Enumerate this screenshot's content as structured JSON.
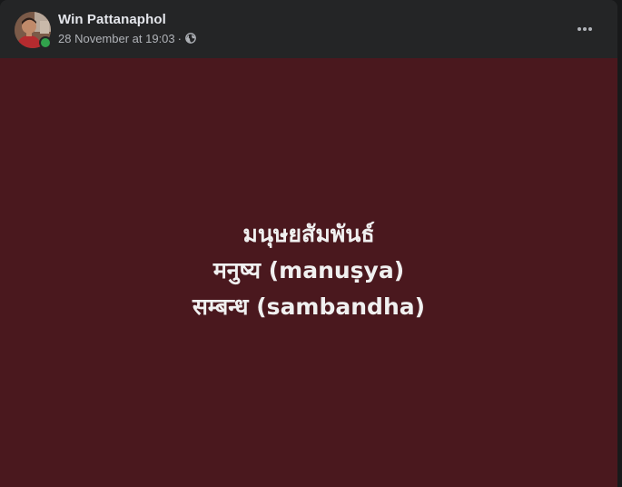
{
  "post": {
    "author": "Win Pattanaphol",
    "timestamp": "28 November at 19:03",
    "separator": "·",
    "visibility_icon": "globe-icon",
    "more_icon": "ellipsis-icon",
    "lines": [
      "มนุษยสัมพันธ์",
      "मनुष्य (manuṣya)",
      "सम्बन्ध (sambandha)"
    ]
  },
  "colors": {
    "background": "#242526",
    "media_background": "#4a181e",
    "text_primary": "#e4e6eb",
    "text_secondary": "#b0b3b8",
    "online": "#31a24c"
  }
}
